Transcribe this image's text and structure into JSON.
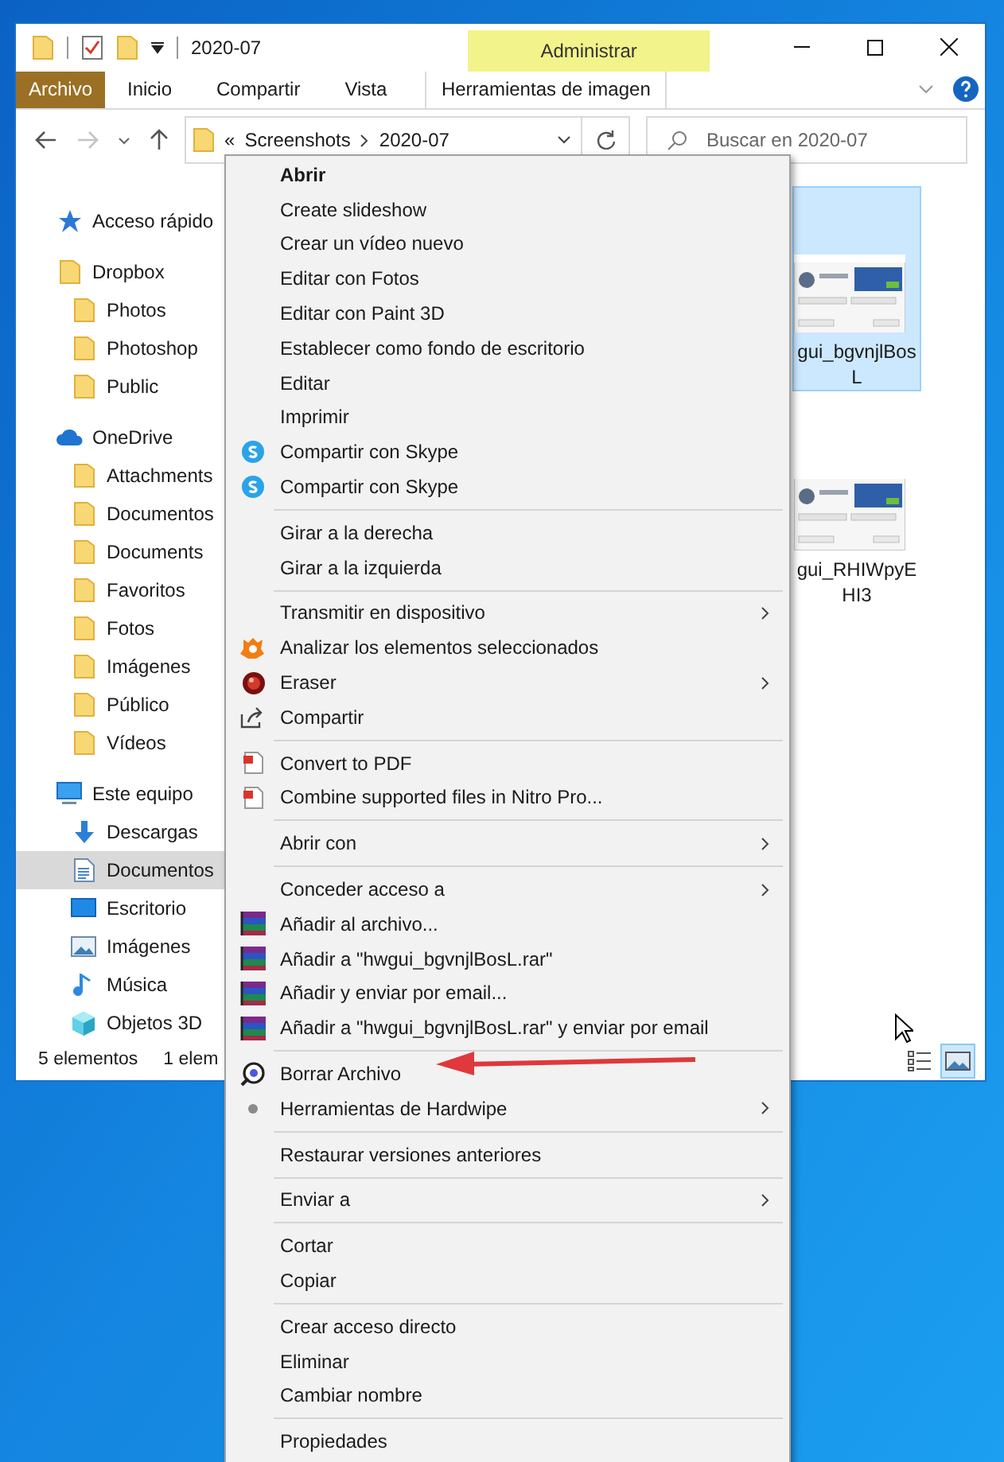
{
  "window": {
    "title": "2020-07"
  },
  "ribbon": {
    "file_tab": "Archivo",
    "tabs": [
      {
        "label": "Inicio",
        "selected": false
      },
      {
        "label": "Compartir",
        "selected": false
      },
      {
        "label": "Vista",
        "selected": false
      }
    ],
    "contextual": {
      "group": "Administrar",
      "tab": "Herramientas de imagen"
    }
  },
  "address_bar": {
    "overflow": "«",
    "path": [
      "Screenshots",
      "2020-07"
    ]
  },
  "search": {
    "placeholder": "Buscar en 2020-07"
  },
  "sidebar": {
    "items": [
      {
        "label": "Acceso rápido",
        "kind": "quick",
        "selected": false
      },
      {
        "label": "Dropbox",
        "kind": "folder",
        "selected": false,
        "children": [
          {
            "label": "Photos",
            "kind": "folder",
            "selected": false
          },
          {
            "label": "Photoshop",
            "kind": "folder",
            "selected": false
          },
          {
            "label": "Public",
            "kind": "folder",
            "selected": false
          }
        ]
      },
      {
        "label": "OneDrive",
        "kind": "cloud",
        "selected": false,
        "children": [
          {
            "label": "Attachments",
            "kind": "folder",
            "selected": false
          },
          {
            "label": "Documentos",
            "kind": "folder",
            "selected": false
          },
          {
            "label": "Documents",
            "kind": "folder",
            "selected": false
          },
          {
            "label": "Favoritos",
            "kind": "folder",
            "selected": false
          },
          {
            "label": "Fotos",
            "kind": "folder",
            "selected": false
          },
          {
            "label": "Imágenes",
            "kind": "folder",
            "selected": false
          },
          {
            "label": "Público",
            "kind": "folder",
            "selected": false
          },
          {
            "label": "Vídeos",
            "kind": "folder",
            "selected": false
          }
        ]
      },
      {
        "label": "Este equipo",
        "kind": "pc",
        "selected": false,
        "children": [
          {
            "label": "Descargas",
            "kind": "downloads",
            "selected": false
          },
          {
            "label": "Documentos",
            "kind": "documents",
            "selected": true
          },
          {
            "label": "Escritorio",
            "kind": "desktop",
            "selected": false
          },
          {
            "label": "Imágenes",
            "kind": "pictures",
            "selected": false
          },
          {
            "label": "Música",
            "kind": "music",
            "selected": false
          },
          {
            "label": "Objetos 3D",
            "kind": "objects3d",
            "selected": false
          }
        ]
      }
    ]
  },
  "files": [
    {
      "name": "gui_bgvnjlBosL",
      "selected": true,
      "kind": "picture"
    },
    {
      "name": "gui_RHIWpyEHI3",
      "selected": false,
      "kind": "picture"
    }
  ],
  "status_bar": {
    "count": "5 elementos",
    "selection": "1 elem",
    "view_modes": [
      {
        "kind": "details",
        "selected": false
      },
      {
        "kind": "thumbnails",
        "selected": true
      }
    ]
  },
  "context_menu": {
    "items": [
      {
        "kind": "plain",
        "label": "Abrir",
        "default": true
      },
      {
        "kind": "plain",
        "label": "Create slideshow"
      },
      {
        "kind": "plain",
        "label": "Crear un vídeo nuevo"
      },
      {
        "kind": "plain",
        "label": "Editar con Fotos"
      },
      {
        "kind": "plain",
        "label": "Editar con Paint 3D"
      },
      {
        "kind": "plain",
        "label": "Establecer como fondo de escritorio"
      },
      {
        "kind": "plain",
        "label": "Editar"
      },
      {
        "kind": "plain",
        "label": "Imprimir"
      },
      {
        "kind": "skype",
        "label": "Compartir con Skype"
      },
      {
        "kind": "skype",
        "label": "Compartir con Skype"
      },
      {
        "kind": "separator"
      },
      {
        "kind": "plain",
        "label": "Girar a la derecha"
      },
      {
        "kind": "plain",
        "label": "Girar a la izquierda"
      },
      {
        "kind": "separator"
      },
      {
        "kind": "plain",
        "label": "Transmitir en dispositivo",
        "submenu": true
      },
      {
        "kind": "avast",
        "label": "Analizar los elementos seleccionados"
      },
      {
        "kind": "eraser",
        "label": "Eraser",
        "submenu": true
      },
      {
        "kind": "share",
        "label": "Compartir"
      },
      {
        "kind": "separator"
      },
      {
        "kind": "pdf",
        "label": "Convert to PDF"
      },
      {
        "kind": "pdf",
        "label": "Combine supported files in Nitro Pro..."
      },
      {
        "kind": "separator"
      },
      {
        "kind": "plain",
        "label": "Abrir con",
        "submenu": true
      },
      {
        "kind": "separator"
      },
      {
        "kind": "plain",
        "label": "Conceder acceso a",
        "submenu": true
      },
      {
        "kind": "winrar",
        "label": "Añadir al archivo..."
      },
      {
        "kind": "winrar",
        "label": "Añadir a \"hwgui_bgvnjlBosL.rar\""
      },
      {
        "kind": "winrar",
        "label": "Añadir y enviar por email..."
      },
      {
        "kind": "winrar",
        "label": "Añadir a \"hwgui_bgvnjlBosL.rar\" y enviar por email"
      },
      {
        "kind": "separator"
      },
      {
        "kind": "hardwipe",
        "label": "Borrar Archivo"
      },
      {
        "kind": "dot",
        "label": "Herramientas de Hardwipe",
        "submenu": true
      },
      {
        "kind": "separator"
      },
      {
        "kind": "plain",
        "label": "Restaurar versiones anteriores"
      },
      {
        "kind": "separator"
      },
      {
        "kind": "plain",
        "label": "Enviar a",
        "submenu": true
      },
      {
        "kind": "separator"
      },
      {
        "kind": "plain",
        "label": "Cortar"
      },
      {
        "kind": "plain",
        "label": "Copiar"
      },
      {
        "kind": "separator"
      },
      {
        "kind": "plain",
        "label": "Crear acceso directo"
      },
      {
        "kind": "plain",
        "label": "Eliminar"
      },
      {
        "kind": "plain",
        "label": "Cambiar nombre"
      },
      {
        "kind": "separator"
      },
      {
        "kind": "plain",
        "label": "Propiedades"
      }
    ]
  }
}
